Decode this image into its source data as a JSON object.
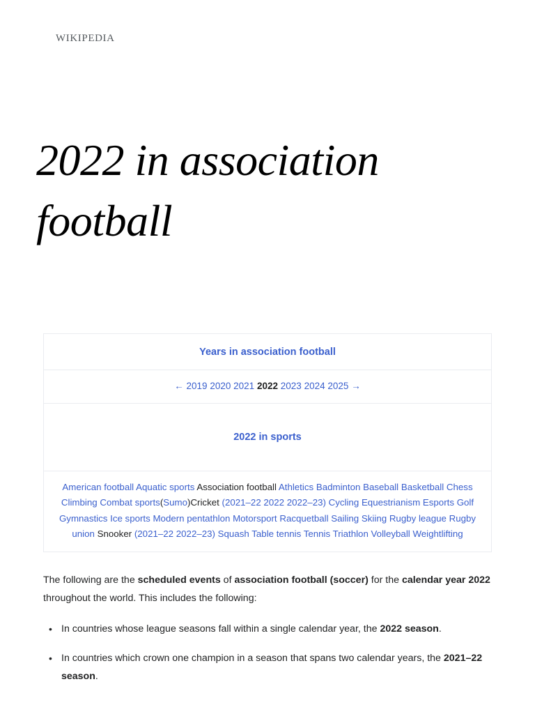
{
  "site": {
    "wordmark": "Wikipedia"
  },
  "article": {
    "title": "2022 in association football"
  },
  "navbox": {
    "title": "Years in association football",
    "subtitle": "2022 in sports",
    "year_nav": {
      "prev_arrow": "←",
      "next_arrow": "→",
      "years": [
        "2019",
        "2020",
        "2021",
        "2022",
        "2023",
        "2024",
        "2025"
      ],
      "current": "2022"
    },
    "sports": [
      {
        "label": "American football",
        "link": true
      },
      {
        "label": "Aquatic sports",
        "link": true
      },
      {
        "label": "Association football",
        "link": false
      },
      {
        "label": "Athletics",
        "link": true
      },
      {
        "label": "Badminton",
        "link": true
      },
      {
        "label": "Baseball",
        "link": true
      },
      {
        "label": "Basketball",
        "link": true
      },
      {
        "label": "Chess",
        "link": true
      },
      {
        "label": "Climbing",
        "link": true
      },
      {
        "label": "Combat sports",
        "link": true
      },
      {
        "label": "(",
        "link": false,
        "nospace": true
      },
      {
        "label": "Sumo",
        "link": true
      },
      {
        "label": ")",
        "link": false,
        "nospace": true
      },
      {
        "label": "Cricket",
        "link": false
      },
      {
        "label": "(2021–22",
        "link": true
      },
      {
        "label": "2022",
        "link": true
      },
      {
        "label": "2022–23)",
        "link": true
      },
      {
        "label": "Cycling",
        "link": true
      },
      {
        "label": "Equestrianism",
        "link": true
      },
      {
        "label": "Esports",
        "link": true
      },
      {
        "label": "Golf",
        "link": true
      },
      {
        "label": "Gymnastics",
        "link": true
      },
      {
        "label": "Ice sports",
        "link": true
      },
      {
        "label": "Modern pentathlon",
        "link": true
      },
      {
        "label": "Motorsport",
        "link": true
      },
      {
        "label": "Racquetball",
        "link": true
      },
      {
        "label": "Sailing",
        "link": true
      },
      {
        "label": "Skiing",
        "link": true
      },
      {
        "label": "Rugby league",
        "link": true
      },
      {
        "label": "Rugby union",
        "link": true
      },
      {
        "label": "Snooker",
        "link": false
      },
      {
        "label": "(2021–22",
        "link": true
      },
      {
        "label": "2022–23)",
        "link": true
      },
      {
        "label": "Squash",
        "link": true
      },
      {
        "label": "Table tennis",
        "link": true
      },
      {
        "label": "Tennis",
        "link": true
      },
      {
        "label": "Triathlon",
        "link": true
      },
      {
        "label": "Volleyball",
        "link": true
      },
      {
        "label": "Weightlifting",
        "link": true
      }
    ]
  },
  "content": {
    "paragraph": [
      {
        "text": "The following are the ",
        "bold": false
      },
      {
        "text": "scheduled events",
        "bold": true
      },
      {
        "text": " of ",
        "bold": false
      },
      {
        "text": "association football (soccer)",
        "bold": true
      },
      {
        "text": " for the ",
        "bold": false
      },
      {
        "text": "calendar year 2022",
        "bold": true
      },
      {
        "text": " throughout the world. This includes the following:",
        "bold": false
      }
    ],
    "bullets": [
      [
        {
          "text": "In countries whose league seasons fall within a single calendar year, the ",
          "bold": false
        },
        {
          "text": "2022 season",
          "bold": true
        },
        {
          "text": ".",
          "bold": false
        }
      ],
      [
        {
          "text": "In countries which crown one champion in a season that spans two calendar years, the ",
          "bold": false
        },
        {
          "text": "2021–22 season",
          "bold": true
        },
        {
          "text": ".",
          "bold": false
        }
      ]
    ]
  },
  "colors": {
    "link": "#3a5fcd",
    "text": "#202122",
    "border": "#eaecf0",
    "wordmark": "#54595d"
  }
}
